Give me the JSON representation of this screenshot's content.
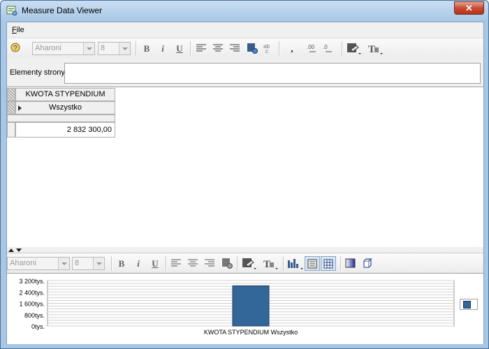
{
  "window": {
    "title": "Measure Data Viewer",
    "close_glyph": "✕"
  },
  "menu": {
    "file_accel": "F",
    "file_rest": "ile"
  },
  "toolbar_top": {
    "font_name": "Aharoni",
    "font_size": "8",
    "bold": "B",
    "italic": "i",
    "underline": "U",
    "comma": ","
  },
  "page_items": {
    "label": "Elementy strony",
    "value": ""
  },
  "grid": {
    "measure_header": "KWOTA STYPENDIUM",
    "dimension_value": "Wszystko",
    "cell_value": "2 832 300,00"
  },
  "toolbar_bottom": {
    "font_name": "Aharoni",
    "font_size": "8",
    "bold": "B",
    "italic": "i",
    "underline": "U"
  },
  "chart_data": {
    "type": "bar",
    "categories": [
      "KWOTA STYPENDIUM Wszystko"
    ],
    "series": [
      {
        "values": [
          2832300
        ]
      }
    ],
    "y_tick_labels": [
      "3 200tys.",
      "2 400tys.",
      "1 600tys.",
      "800tys.",
      "0tys."
    ],
    "ylim": [
      0,
      3200000
    ],
    "grid": true,
    "legend": "right",
    "bar_color": "#336699"
  }
}
